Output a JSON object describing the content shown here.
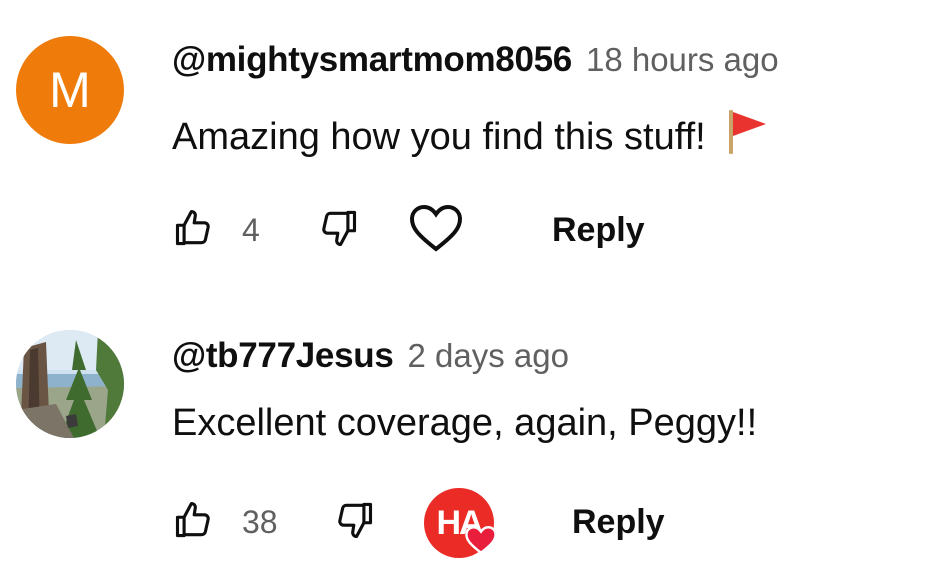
{
  "comments": [
    {
      "avatar_letter": "M",
      "avatar_color": "#ef7b0a",
      "author": "@mightysmartmom8056",
      "time": "18 hours ago",
      "text": "Amazing how you find this stuff!",
      "emoji_icon": "red-flag-icon",
      "like_count": "4",
      "hearted_by_creator": false,
      "reply_label": "Reply"
    },
    {
      "avatar_icon": "landscape-photo-avatar",
      "author": "@tb777Jesus",
      "time": "2 days ago",
      "text": "Excellent coverage, again, Peggy!!",
      "like_count": "38",
      "hearted_by_creator": true,
      "creator_badge_text": "HA",
      "creator_badge_color": "#ea2b26",
      "reply_label": "Reply"
    }
  ]
}
